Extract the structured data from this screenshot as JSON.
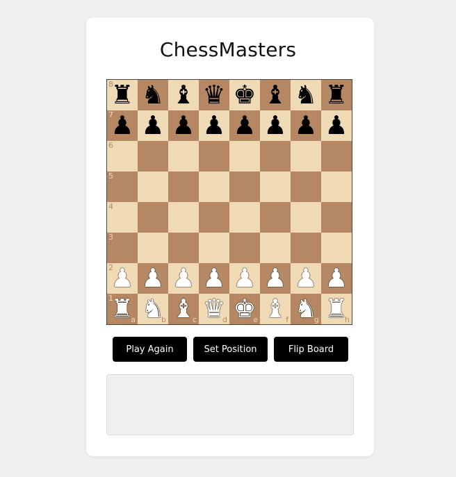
{
  "app": {
    "title": "ChessMasters"
  },
  "board": {
    "ranks": [
      "8",
      "7",
      "6",
      "5",
      "4",
      "3",
      "2",
      "1"
    ],
    "files": [
      "a",
      "b",
      "c",
      "d",
      "e",
      "f",
      "g",
      "h"
    ],
    "pieces": [
      [
        "r",
        "n",
        "b",
        "q",
        "k",
        "b",
        "n",
        "r"
      ],
      [
        "p",
        "p",
        "p",
        "p",
        "p",
        "p",
        "p",
        "p"
      ],
      [
        "",
        "",
        "",
        "",
        "",
        "",
        "",
        ""
      ],
      [
        "",
        "",
        "",
        "",
        "",
        "",
        "",
        ""
      ],
      [
        "",
        "",
        "",
        "",
        "",
        "",
        "",
        ""
      ],
      [
        "",
        "",
        "",
        "",
        "",
        "",
        "",
        ""
      ],
      [
        "P",
        "P",
        "P",
        "P",
        "P",
        "P",
        "P",
        "P"
      ],
      [
        "R",
        "N",
        "B",
        "Q",
        "K",
        "B",
        "N",
        "R"
      ]
    ],
    "colors": {
      "light": "#f0d9b5",
      "dark": "#b58863"
    }
  },
  "controls": {
    "play_again": "Play Again",
    "set_position": "Set Position",
    "flip_board": "Flip Board"
  },
  "status": {
    "text": ""
  }
}
